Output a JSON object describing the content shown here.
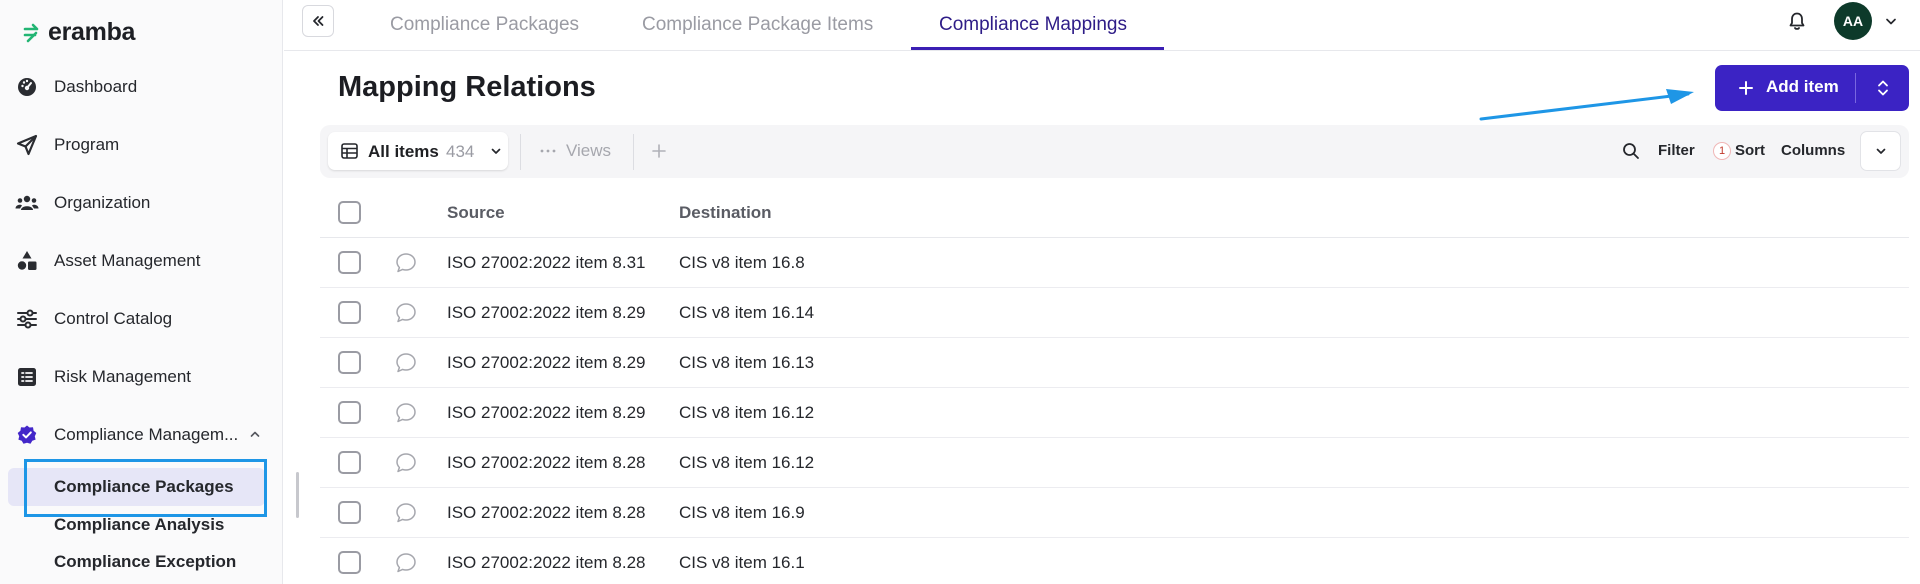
{
  "app": {
    "logo_text": "eramba",
    "brand_color": "#3b23c4"
  },
  "sidebar": {
    "items": [
      {
        "label": "Dashboard",
        "icon": "dashboard-icon"
      },
      {
        "label": "Program",
        "icon": "send-icon"
      },
      {
        "label": "Organization",
        "icon": "users-icon"
      },
      {
        "label": "Asset Management",
        "icon": "shapes-icon"
      },
      {
        "label": "Control Catalog",
        "icon": "sliders-icon"
      },
      {
        "label": "Risk Management",
        "icon": "list-icon"
      },
      {
        "label": "Compliance Managem...",
        "icon": "shield-check-icon",
        "expanded": true
      }
    ],
    "sub_items": [
      {
        "label": "Compliance Packages",
        "active": true
      },
      {
        "label": "Compliance Analysis",
        "active": false
      },
      {
        "label": "Compliance Exception",
        "active": false
      }
    ]
  },
  "topbar": {
    "tabs": [
      {
        "label": "Compliance Packages",
        "active": false
      },
      {
        "label": "Compliance Package Items",
        "active": false
      },
      {
        "label": "Compliance Mappings",
        "active": true
      }
    ],
    "avatar_initials": "AA"
  },
  "header": {
    "title": "Mapping Relations",
    "add_label": "Add item"
  },
  "toolbar": {
    "view_label": "All items",
    "view_count": "434",
    "views_label": "Views",
    "filter_label": "Filter",
    "sort_badge": "1",
    "sort_label": "Sort",
    "columns_label": "Columns"
  },
  "table": {
    "columns": [
      "Source",
      "Destination"
    ],
    "rows": [
      {
        "source": "ISO 27002:2022 item 8.31",
        "destination": "CIS v8 item 16.8"
      },
      {
        "source": "ISO 27002:2022 item 8.29",
        "destination": "CIS v8 item 16.14"
      },
      {
        "source": "ISO 27002:2022 item 8.29",
        "destination": "CIS v8 item 16.13"
      },
      {
        "source": "ISO 27002:2022 item 8.29",
        "destination": "CIS v8 item 16.12"
      },
      {
        "source": "ISO 27002:2022 item 8.28",
        "destination": "CIS v8 item 16.12"
      },
      {
        "source": "ISO 27002:2022 item 8.28",
        "destination": "CIS v8 item 16.9"
      },
      {
        "source": "ISO 27002:2022 item 8.28",
        "destination": "CIS v8 item 16.1"
      }
    ]
  }
}
